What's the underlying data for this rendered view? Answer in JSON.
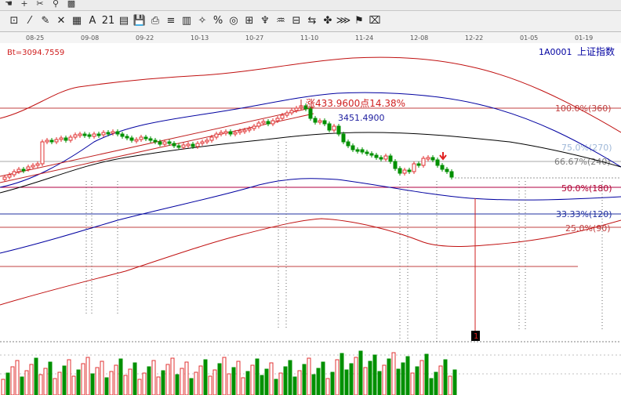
{
  "toolbar_top": [
    "hand-icon",
    "crosshair-icon",
    "scissors-icon",
    "stamp-icon",
    "palette-icon"
  ],
  "toolbar": [
    {
      "name": "select-tool",
      "glyph": "⊡"
    },
    {
      "name": "line-tool",
      "glyph": "⁄"
    },
    {
      "name": "pencil-tool",
      "glyph": "✎"
    },
    {
      "name": "delete-tool",
      "glyph": "✕"
    },
    {
      "name": "grid-tool",
      "glyph": "▦"
    },
    {
      "name": "text-tool",
      "glyph": "A"
    },
    {
      "name": "calendar-tool",
      "glyph": "21"
    },
    {
      "name": "table-tool",
      "glyph": "▤"
    },
    {
      "name": "save-tool",
      "glyph": "💾"
    },
    {
      "name": "print-tool",
      "glyph": "⎙"
    },
    {
      "name": "parallel-tool",
      "glyph": "≡"
    },
    {
      "name": "bars-tool",
      "glyph": "▥"
    },
    {
      "name": "fib-tool",
      "glyph": "✧"
    },
    {
      "name": "percent-tool",
      "glyph": "%"
    },
    {
      "name": "circle-tool",
      "glyph": "◎"
    },
    {
      "name": "gann-tool",
      "glyph": "⊞"
    },
    {
      "name": "speed-tool",
      "glyph": "♆"
    },
    {
      "name": "wave-tool",
      "glyph": "♒"
    },
    {
      "name": "box-tool",
      "glyph": "⊟"
    },
    {
      "name": "arrow-tool",
      "glyph": "⇆"
    },
    {
      "name": "mark-tool",
      "glyph": "✤"
    },
    {
      "name": "zigzag-tool",
      "glyph": "⋙"
    },
    {
      "name": "flag-tool",
      "glyph": "⚑"
    },
    {
      "name": "eraser-tool",
      "glyph": "⌧"
    }
  ],
  "dates": [
    "08-25",
    "09-08",
    "09-22",
    "10-13",
    "10-27",
    "11-10",
    "11-24",
    "12-08",
    "12-22",
    "01-05",
    "01-19"
  ],
  "indicator_label": "Bt=3094.7559",
  "index_code": "1A0001",
  "index_name": "上证指数",
  "rise_label": "涨433.9600点14.38%",
  "price_label": "3451.4900",
  "fib_levels": [
    {
      "label": "100.0%(360)",
      "color": "#c04040"
    },
    {
      "label": "75.0%(270)",
      "color": "#9fb8d8"
    },
    {
      "label": "66.67%(240)",
      "color": "#8a8a8a"
    },
    {
      "label": "50.0%(180)",
      "color": "#c02040"
    },
    {
      "label": "33.33%(120)",
      "color": "#2030a0"
    },
    {
      "label": "25.0%(90)",
      "color": "#c04040"
    }
  ],
  "marker_label": "1",
  "colors": {
    "up": "#e03030",
    "down": "#009000",
    "boll_outer": "#c01010",
    "boll_mid": "#0000a0",
    "ma": "#000000"
  }
}
